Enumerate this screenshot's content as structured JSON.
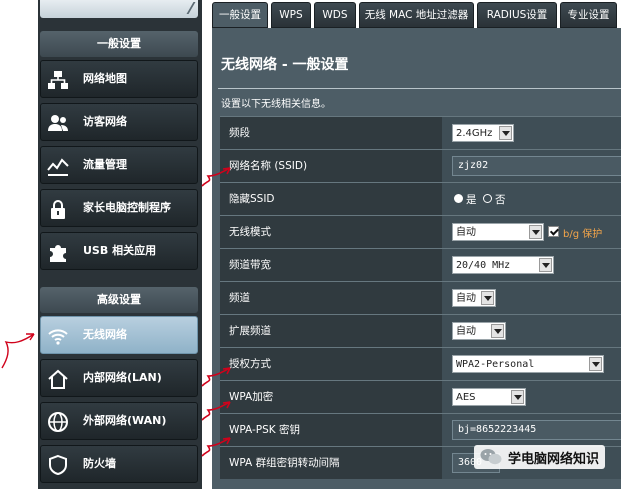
{
  "sidebar": {
    "general_header": "一般设置",
    "general_items": [
      {
        "label": "网络地图",
        "icon": "network-map-icon"
      },
      {
        "label": "访客网络",
        "icon": "guest-network-icon"
      },
      {
        "label": "流量管理",
        "icon": "traffic-manager-icon"
      },
      {
        "label": "家长电脑控制程序",
        "icon": "parental-control-icon"
      },
      {
        "label": "USB 相关应用",
        "icon": "usb-puzzle-icon"
      }
    ],
    "advanced_header": "高级设置",
    "advanced_items": [
      {
        "label": "无线网络",
        "icon": "wifi-icon",
        "active": true
      },
      {
        "label": "内部网络(LAN)",
        "icon": "home-icon"
      },
      {
        "label": "外部网络(WAN)",
        "icon": "globe-icon"
      },
      {
        "label": "防火墙",
        "icon": "shield-icon"
      }
    ]
  },
  "tabs": [
    "一般设置",
    "WPS",
    "WDS",
    "无线 MAC 地址过滤器",
    "RADIUS设置",
    "专业设置"
  ],
  "active_tab": 0,
  "main": {
    "title": "无线网络 - 一般设置",
    "description": "设置以下无线相关信息。"
  },
  "settings": {
    "band": {
      "label": "频段",
      "value": "2.4GHz"
    },
    "ssid": {
      "label": "网络名称 (SSID)",
      "value": "zjz02"
    },
    "hide_ssid": {
      "label": "隐藏SSID",
      "yes": "是",
      "no": "否",
      "selected": "no"
    },
    "wireless_mode": {
      "label": "无线模式",
      "value": "自动",
      "bg_protection_checked": true,
      "bg_protection_label": "b/g 保护"
    },
    "channel_bandwidth": {
      "label": "频道带宽",
      "value": "20/40 MHz"
    },
    "channel": {
      "label": "频道",
      "value": "自动"
    },
    "extension_channel": {
      "label": "扩展频道",
      "value": "自动"
    },
    "auth_method": {
      "label": "授权方式",
      "value": "WPA2-Personal"
    },
    "wpa_encryption": {
      "label": "WPA加密",
      "value": "AES"
    },
    "wpa_psk": {
      "label": "WPA-PSK 密钥",
      "value": "bj=8652223445"
    },
    "group_key_interval": {
      "label": "WPA 群组密钥转动间隔",
      "value": "3600"
    }
  },
  "watermark": {
    "text": "学电脑网络知识"
  },
  "colors": {
    "annotation": "#d0021b",
    "active_item": "#a9c6d8",
    "panel": "#4d5d66"
  }
}
